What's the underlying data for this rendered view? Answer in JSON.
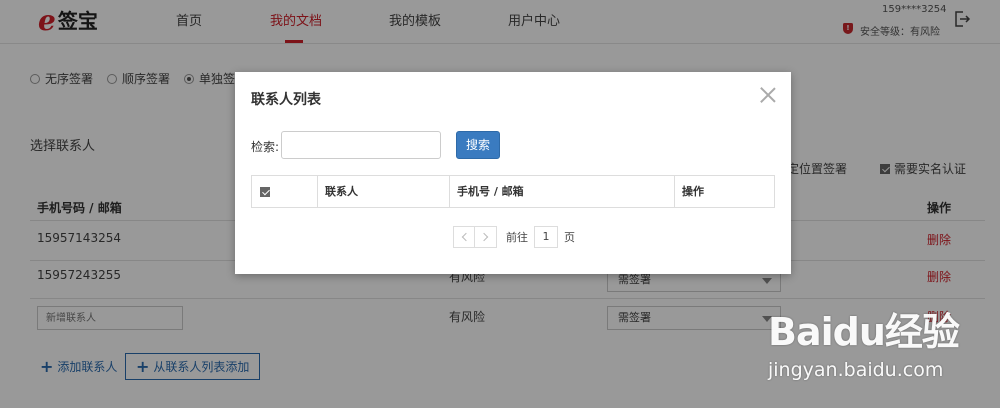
{
  "header": {
    "logo_mark": "e",
    "logo_text": "签宝",
    "nav": [
      "首页",
      "我的文档",
      "我的模板",
      "用户中心"
    ],
    "active_nav": "我的文档",
    "phone": "159****3254",
    "security": "安全等级：有风险",
    "shield_glyph": "!"
  },
  "sign_mode": {
    "options": [
      "无序签署",
      "顺序签署",
      "单独签署"
    ],
    "selected": "单独签署"
  },
  "contacts_section": {
    "title": "选择联系人",
    "opt_position": "指定位置签署",
    "opt_realname": "需要实名认证",
    "columns": [
      "手机号码 / 邮箱",
      "操作"
    ],
    "rows": [
      {
        "contact": "15957143254",
        "risk": "",
        "sign": "",
        "action": "删除"
      },
      {
        "contact": "15957243255",
        "risk": "有风险",
        "sign": "需签署",
        "action": "删除"
      },
      {
        "contact": "",
        "risk": "有风险",
        "sign": "需签署",
        "action": "删除"
      }
    ],
    "new_placeholder": "新增联系人",
    "add_contact": "添加联系人",
    "add_from_list": "从联系人列表添加"
  },
  "modal": {
    "title": "联系人列表",
    "search_label": "检索:",
    "search_value": "",
    "search_button": "搜索",
    "columns": [
      "联系人",
      "手机号 / 邮箱",
      "操作"
    ],
    "pager": {
      "goto_label": "前往",
      "page": "1",
      "page_suffix": "页"
    }
  },
  "watermark": {
    "main": "Baidu经验",
    "sub": "jingyan.baidu.com"
  },
  "colors": {
    "brand_red": "#d0202a",
    "primary_blue": "#3a7bc0"
  }
}
